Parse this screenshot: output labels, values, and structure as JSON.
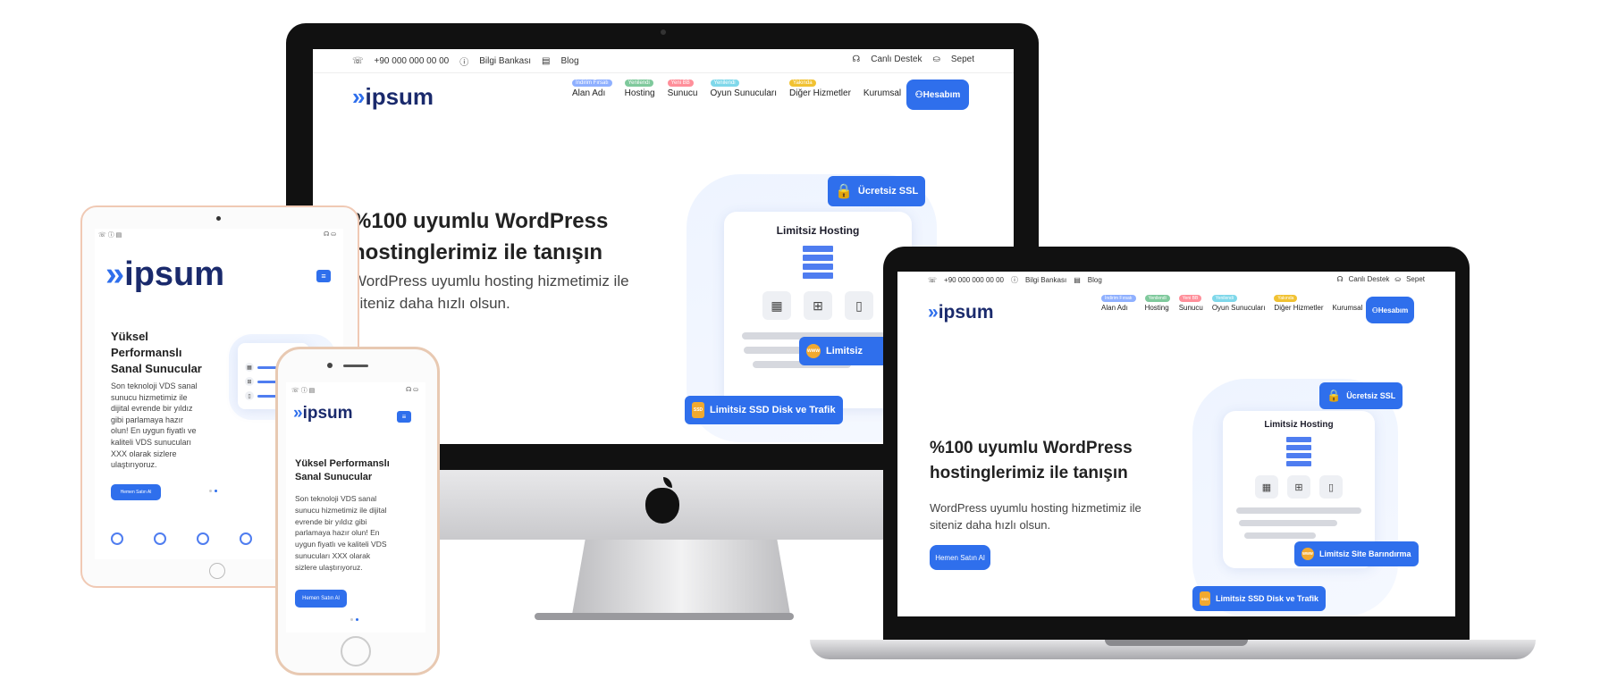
{
  "site": {
    "brand": "ipsum",
    "phone": "+90 000 000 00 00",
    "knowledge_base": "Bilgi Bankası",
    "blog": "Blog",
    "live_support": "Canlı Destek",
    "cart": "Sepet",
    "account_button": "Hesabım",
    "nav": [
      {
        "label": "Alan Adı",
        "badge": "İndirim Fırsatı",
        "badge_color": "#8fb0ff"
      },
      {
        "label": "Hosting",
        "badge": "Yenilendi",
        "badge_color": "#7fc99c"
      },
      {
        "label": "Sunucu",
        "badge": "Yeni BB",
        "badge_color": "#ff8f9a"
      },
      {
        "label": "Oyun Sunucuları",
        "badge": "Yenilendi",
        "badge_color": "#7fd8ea"
      },
      {
        "label": "Diğer Hizmetler",
        "badge": "Yakında",
        "badge_color": "#f1c232"
      },
      {
        "label": "Kurumsal",
        "badge": "",
        "badge_color": ""
      }
    ],
    "hero": {
      "title_line1": "%100 uyumlu WordPress",
      "title_line2": "hostinglerimiz ile tanışın",
      "text_line1": "WordPress uyumlu hosting hizmetimiz ile",
      "text_line2": "siteniz daha hızlı olsun.",
      "cta": "Hemen Satın Al"
    },
    "illustration": {
      "card_title": "Limitsiz Hosting",
      "ssl_label": "Ücretsiz SSL",
      "site_label": "Limitsiz Site Barındırma",
      "site_label_short": "Limitsiz",
      "disk_label": "Limitsiz SSD Disk ve Trafik",
      "www": "www",
      "ssd": "SSD"
    }
  },
  "mobile": {
    "title_line1": "Yüksel",
    "title_line2": "Performanslı",
    "title_line3": "Sanal Sunucular",
    "phone_title_line1": "Yüksel Performanslı",
    "phone_title_line2": "Sanal Sunucular",
    "text": "Son teknoloji VDS sanal sunucu hizmetimiz ile dijital evrende bir yıldız gibi parlamaya hazır olun! En uygun fiyatlı ve kaliteli VDS sunucuları XXX olarak sizlere ulaştırıyoruz.",
    "tablet_text_lines": [
      "Son teknoloji VDS sanal",
      "sunucu hizmetimiz ile",
      "dijital evrende bir yıldız",
      "gibi parlamaya hazır",
      "olun! En uygun fiyatlı ve",
      "kaliteli VDS sunucuları",
      "XXX olarak sizlere",
      "ulaştırıyoruz."
    ],
    "phone_text_lines": [
      "Son teknoloji VDS sanal",
      "sunucu hizmetimiz ile dijital",
      "evrende bir yıldız gibi",
      "parlamaya hazır olun! En",
      "uygun fiyatlı ve kaliteli VDS",
      "sunucuları XXX olarak",
      "sizlere ulaştırıyoruz."
    ],
    "cta": "Hemen Satın Al",
    "menu_icon": "menu-icon"
  },
  "colors": {
    "primary": "#2f6fec",
    "brand_text": "#1a2a6c",
    "accent_yellow": "#f1a92f"
  },
  "icons": [
    "phone-icon",
    "info-icon",
    "blog-icon",
    "headset-icon",
    "cart-icon",
    "user-icon",
    "lock-icon",
    "server-icon",
    "ram-icon",
    "cpu-icon",
    "disk-icon",
    "apple-logo-icon"
  ]
}
